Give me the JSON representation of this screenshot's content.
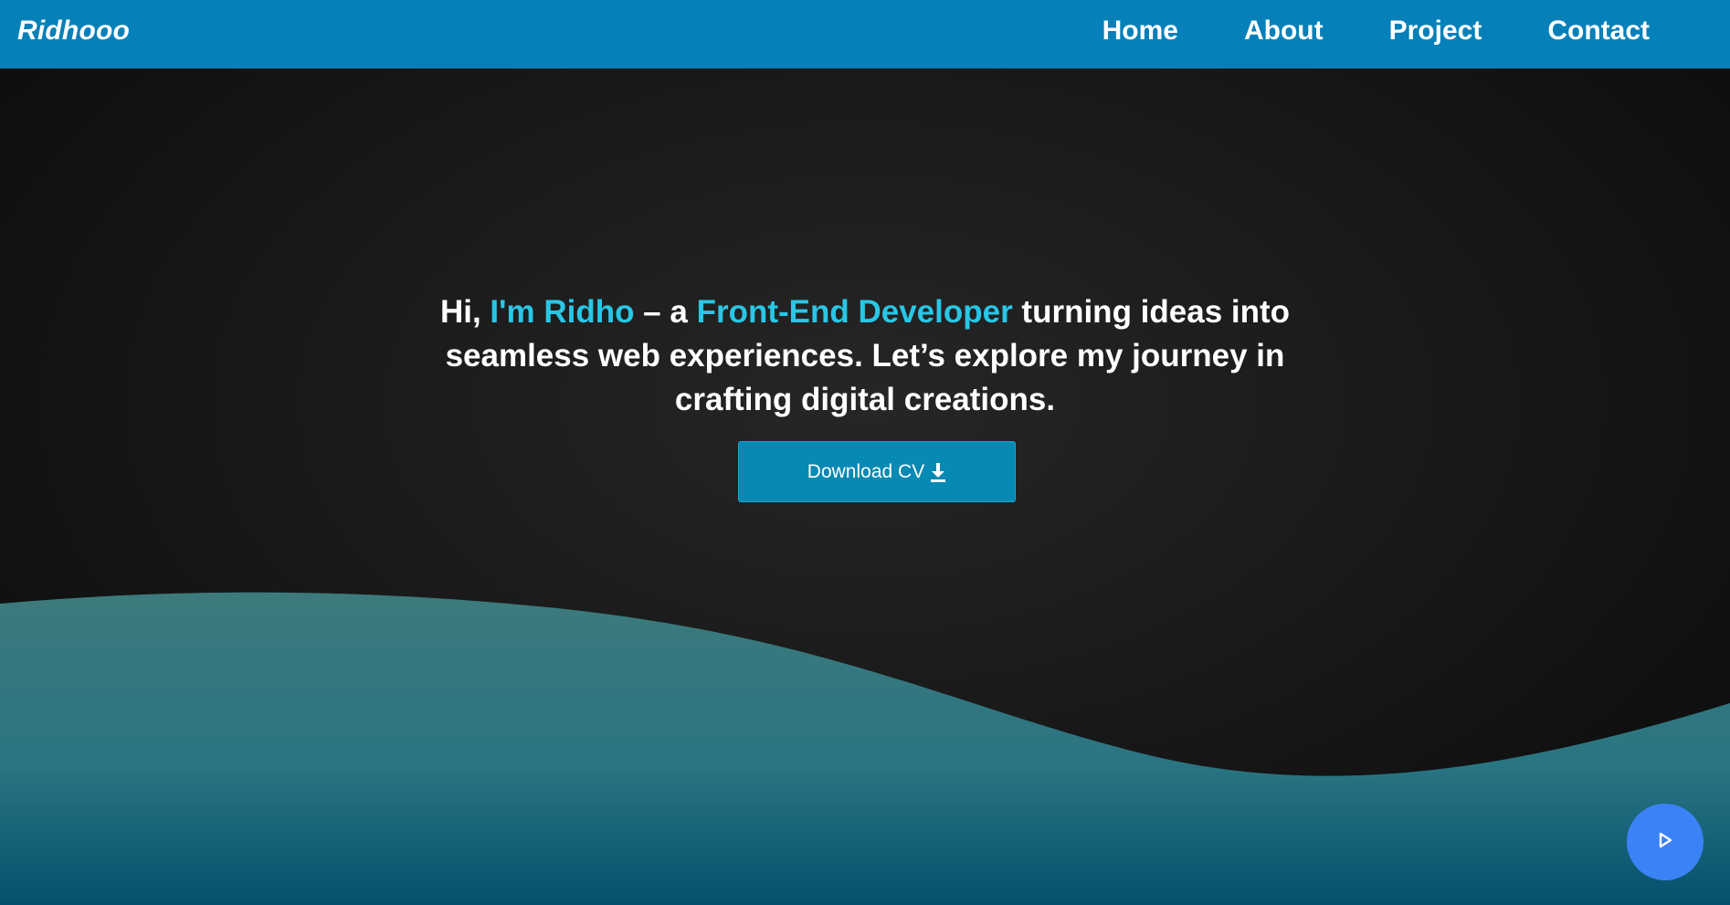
{
  "nav": {
    "brand": "Ridhooo",
    "links": [
      "Home",
      "About",
      "Project",
      "Contact"
    ]
  },
  "hero": {
    "greeting": "Hi, ",
    "name": "I'm Ridho",
    "connector": " – a ",
    "role": "Front-End Developer",
    "rest": " turning ideas into seamless web experiences. Let’s explore my journey in crafting digital creations.",
    "cta_label": "Download CV",
    "cta_icon": "download-icon"
  },
  "fab": {
    "icon": "play-icon"
  },
  "colors": {
    "navbar": "#0580b8",
    "accent": "#29c6e6",
    "button": "#0689b3",
    "wave_top": "#3d7a7c",
    "wave_bottom": "#04506c",
    "fab": "#3b82f6"
  }
}
